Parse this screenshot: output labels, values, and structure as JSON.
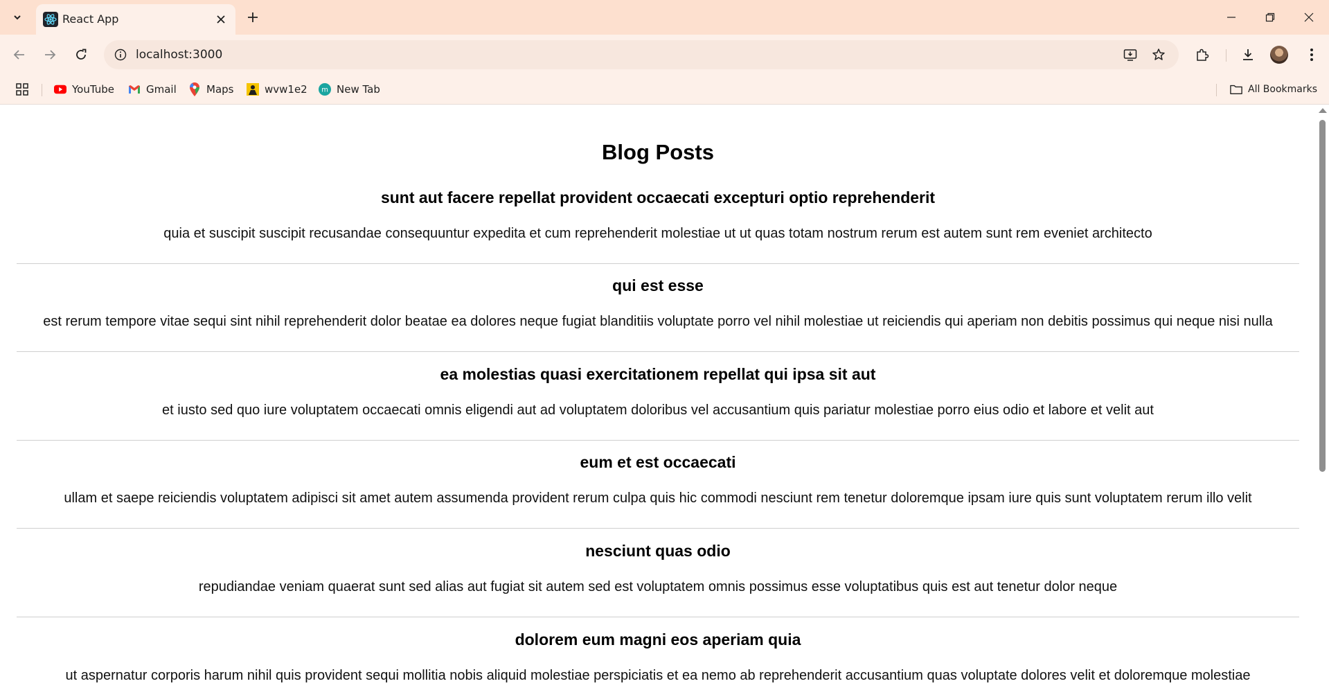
{
  "browser": {
    "tab": {
      "title": "React App"
    },
    "address_bar": {
      "url": "localhost:3000"
    },
    "bookmarks": [
      {
        "label": "YouTube",
        "icon": "youtube-icon"
      },
      {
        "label": "Gmail",
        "icon": "gmail-icon"
      },
      {
        "label": "Maps",
        "icon": "maps-icon"
      },
      {
        "label": "wvw1e2",
        "icon": "bookmark-favicon-icon"
      },
      {
        "label": "New Tab",
        "icon": "new-tab-favicon-icon"
      }
    ],
    "all_bookmarks_label": "All Bookmarks",
    "colors": {
      "titlebar": "#fde0cf",
      "toolbar": "#fdf0e9",
      "omnibox": "#f7e7de"
    }
  },
  "page": {
    "heading": "Blog Posts",
    "posts": [
      {
        "title": "sunt aut facere repellat provident occaecati excepturi optio reprehenderit",
        "body": "quia et suscipit suscipit recusandae consequuntur expedita et cum reprehenderit molestiae ut ut quas totam nostrum rerum est autem sunt rem eveniet architecto"
      },
      {
        "title": "qui est esse",
        "body": "est rerum tempore vitae sequi sint nihil reprehenderit dolor beatae ea dolores neque fugiat blanditiis voluptate porro vel nihil molestiae ut reiciendis qui aperiam non debitis possimus qui neque nisi nulla"
      },
      {
        "title": "ea molestias quasi exercitationem repellat qui ipsa sit aut",
        "body": "et iusto sed quo iure voluptatem occaecati omnis eligendi aut ad voluptatem doloribus vel accusantium quis pariatur molestiae porro eius odio et labore et velit aut"
      },
      {
        "title": "eum et est occaecati",
        "body": "ullam et saepe reiciendis voluptatem adipisci sit amet autem assumenda provident rerum culpa quis hic commodi nesciunt rem tenetur doloremque ipsam iure quis sunt voluptatem rerum illo velit"
      },
      {
        "title": "nesciunt quas odio",
        "body": "repudiandae veniam quaerat sunt sed alias aut fugiat sit autem sed est voluptatem omnis possimus esse voluptatibus quis est aut tenetur dolor neque"
      },
      {
        "title": "dolorem eum magni eos aperiam quia",
        "body": "ut aspernatur corporis harum nihil quis provident sequi mollitia nobis aliquid molestiae perspiciatis et ea nemo ab reprehenderit accusantium quas voluptate dolores velit et doloremque molestiae"
      }
    ]
  }
}
